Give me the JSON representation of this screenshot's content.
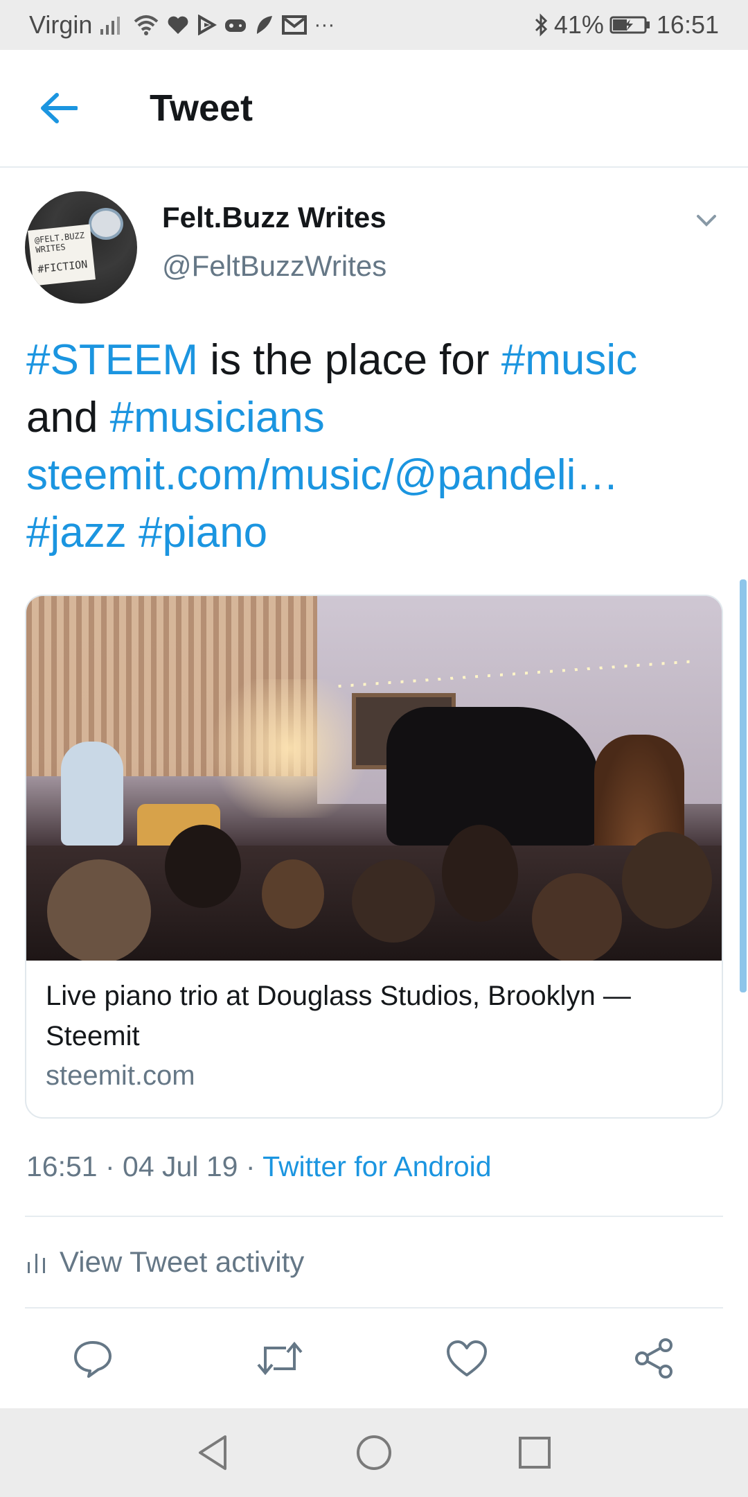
{
  "status_bar": {
    "carrier": "Virgin",
    "more_indicator": "···",
    "battery_percent": "41%",
    "time": "16:51",
    "icons": [
      "signal-icon",
      "wifi-icon",
      "heart-icon",
      "play-store-icon",
      "game-icon",
      "feather-icon",
      "mail-icon",
      "bluetooth-icon",
      "battery-charging-icon"
    ]
  },
  "header": {
    "title": "Tweet",
    "back_icon": "arrow-left-icon"
  },
  "tweet": {
    "author_name": "Felt.Buzz Writes",
    "author_handle": "@FeltBuzzWrites",
    "avatar_text": [
      "@FELT.BUZZ",
      "WRITES",
      "#FICTION"
    ],
    "text": {
      "line1_hashtag": "#STEEM",
      "line1_text": " is the place for ",
      "line1_hashtag2": "#music",
      "line2_text": "and ",
      "line2_hashtag": "#musicians",
      "line3_link": "steemit.com/music/@pandeli…",
      "line4_hashtag1": "#jazz",
      "line4_space": " ",
      "line4_hashtag2": "#piano"
    },
    "card": {
      "title": "Live piano trio at Douglass Studios, Brooklyn — Steemit",
      "domain": "steemit.com"
    },
    "meta": {
      "time": "16:51",
      "separator": " · ",
      "date": "04 Jul 19",
      "separator2": " · ",
      "source": "Twitter for Android"
    },
    "activity_label": "View Tweet activity"
  },
  "colors": {
    "link_blue": "#1b95e0",
    "text_dark": "#14171a",
    "text_gray": "#657786",
    "status_bar_bg": "#ececec"
  }
}
